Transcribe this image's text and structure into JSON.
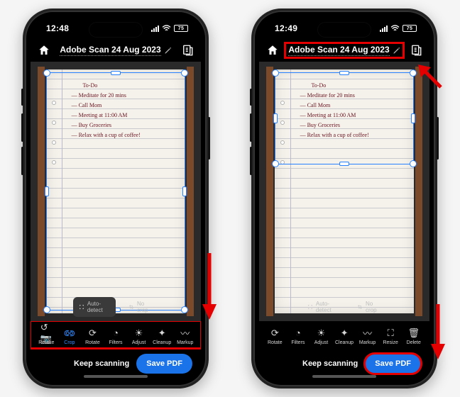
{
  "left": {
    "statusbar": {
      "time": "12:48",
      "battery": "75"
    },
    "header": {
      "title": "Adobe Scan 24 Aug 2023"
    },
    "note": {
      "heading": "To-Do",
      "lines": [
        "— Meditate for 20 mins",
        "— Call Mom",
        "— Meeting at 11:00 AM",
        "— Buy Groceries",
        "— Relax with a cup of coffee!"
      ]
    },
    "crop_toolbar": {
      "auto_detect": "Auto-detect",
      "no_crop": "No crop"
    },
    "tools": [
      {
        "id": "retake",
        "label": "Retake",
        "glyph": "↺📷"
      },
      {
        "id": "crop",
        "label": "Crop",
        "glyph": "⟃⟄",
        "active": true
      },
      {
        "id": "rotate",
        "label": "Rotate",
        "glyph": "⟳"
      },
      {
        "id": "filters",
        "label": "Filters",
        "glyph": "◔"
      },
      {
        "id": "adjust",
        "label": "Adjust",
        "glyph": "☀"
      },
      {
        "id": "cleanup",
        "label": "Cleanup",
        "glyph": "✦"
      },
      {
        "id": "markup",
        "label": "Markup",
        "glyph": "〰"
      }
    ],
    "bottom": {
      "keep": "Keep scanning",
      "save": "Save PDF"
    }
  },
  "right": {
    "statusbar": {
      "time": "12:49",
      "battery": "75"
    },
    "header": {
      "title": "Adobe Scan 24 Aug 2023"
    },
    "note": {
      "heading": "To-Do",
      "lines": [
        "— Meditate for 20 mins",
        "— Call Mom",
        "— Meeting at 11:00 AM",
        "— Buy Groceries",
        "— Relax with a cup of coffee!"
      ]
    },
    "crop_toolbar": {
      "auto_detect": "Auto-detect",
      "no_crop": "No crop"
    },
    "tools": [
      {
        "id": "rotate",
        "label": "Rotate",
        "glyph": "⟳"
      },
      {
        "id": "filters",
        "label": "Filters",
        "glyph": "◔"
      },
      {
        "id": "adjust",
        "label": "Adjust",
        "glyph": "☀"
      },
      {
        "id": "cleanup",
        "label": "Cleanup",
        "glyph": "✦"
      },
      {
        "id": "markup",
        "label": "Markup",
        "glyph": "〰"
      },
      {
        "id": "resize",
        "label": "Resize",
        "glyph": "⛶"
      },
      {
        "id": "delete",
        "label": "Delete",
        "glyph": "🗑"
      }
    ],
    "bottom": {
      "keep": "Keep scanning",
      "save": "Save PDF"
    }
  }
}
